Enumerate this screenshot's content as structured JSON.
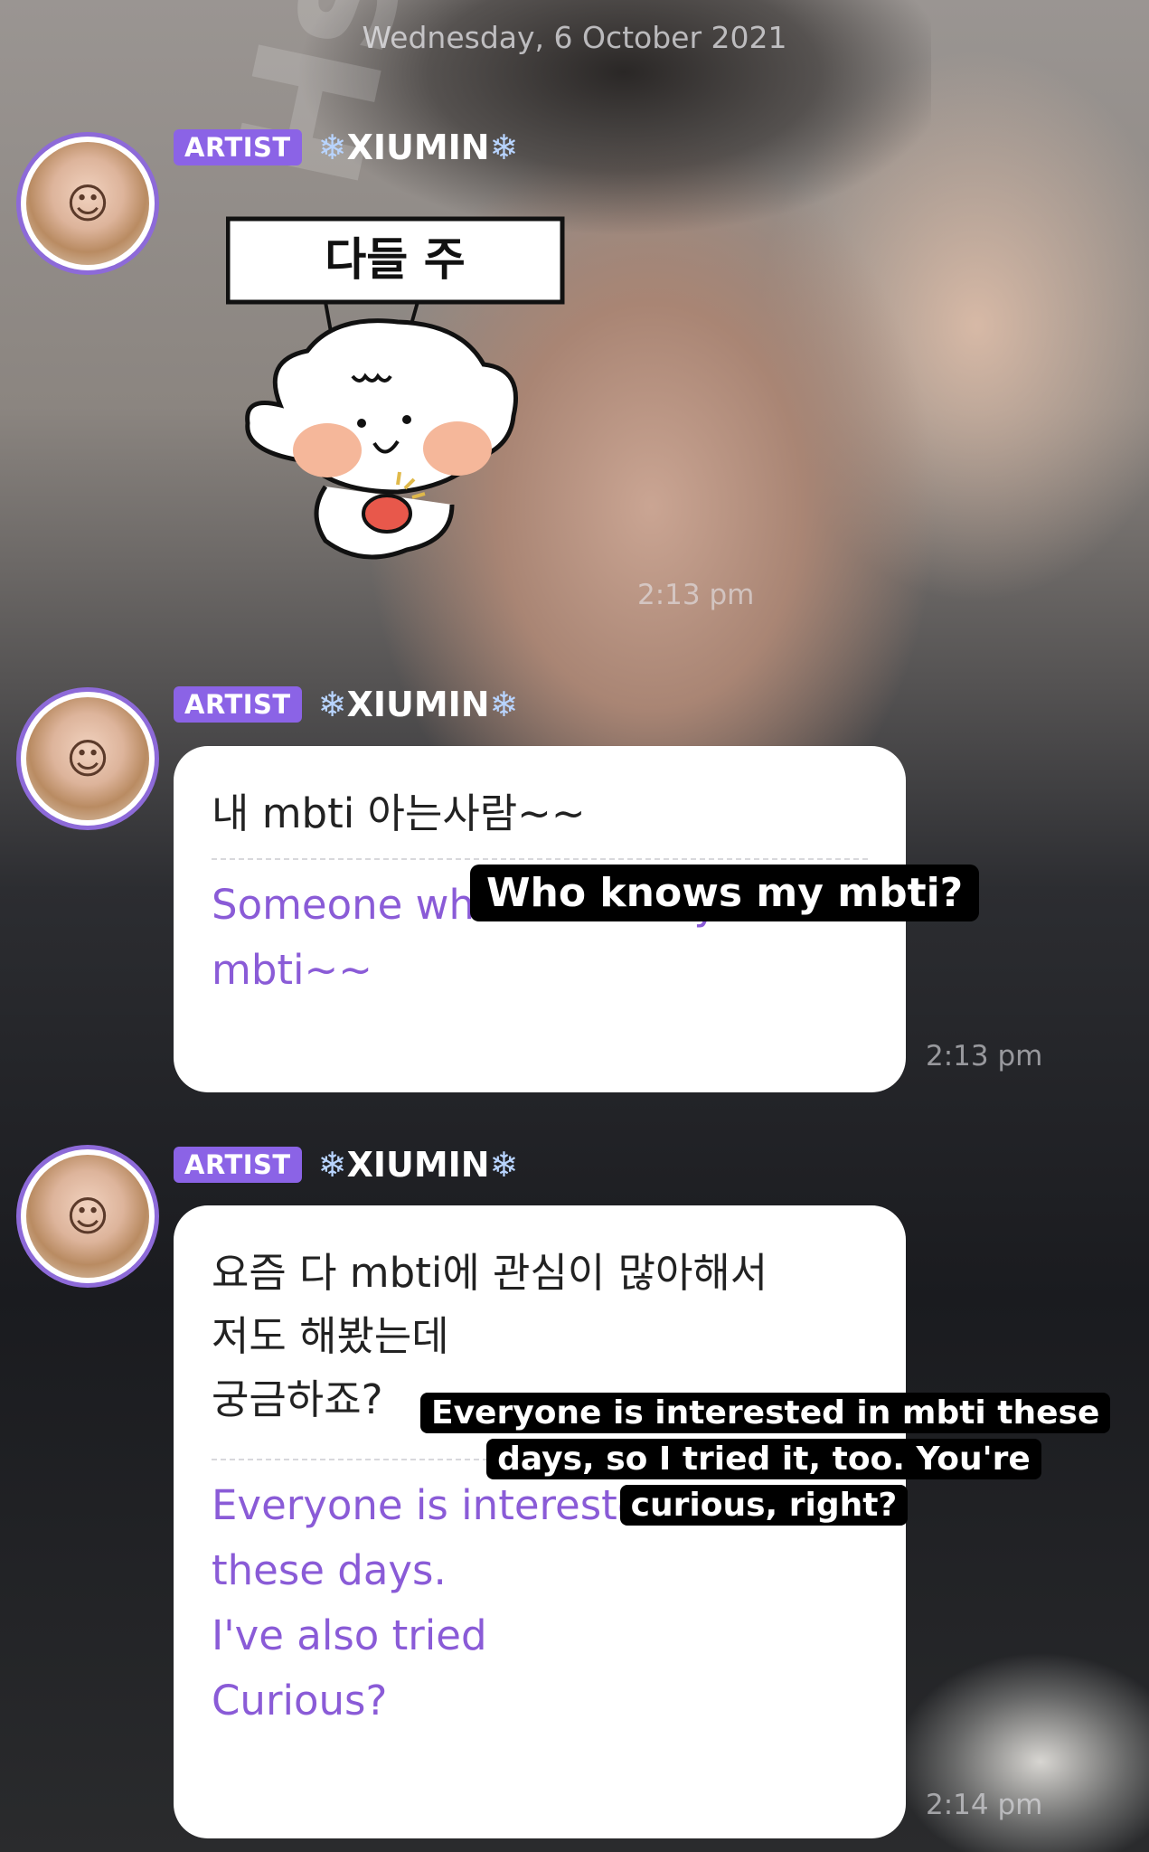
{
  "date_header": "Wednesday, 6 October 2021",
  "sender": {
    "badge": "ARTIST",
    "name": "XIUMIN",
    "name_decoration": "❄",
    "avatar_icon": "profile-photo"
  },
  "sticker": {
    "sign_text": "다들 주",
    "icon": "baby-character-sticker"
  },
  "messages": [
    {
      "type": "sticker",
      "time": "2:13 pm"
    },
    {
      "type": "text",
      "korean": "내 mbti 아는사람~~",
      "translation": "Someone who knows my\nmbti~~",
      "time": "2:13 pm"
    },
    {
      "type": "text",
      "korean": "요즘 다 mbti에 관심이 많아해서\n 저도 해봤는데\n궁금하죠?",
      "translation": "Everyone is interested in mbti\nthese days.\n I've also tried\nCurious?",
      "time": "2:14 pm"
    }
  ],
  "captions": [
    "Who knows my mbti?",
    "Everyone is interested in mbti these days, so I tried it, too. You're curious, right?"
  ],
  "watermark": "HsuHsuHsu",
  "colors": {
    "badge": "#8b63e6",
    "translation_text": "#8a5bd7",
    "avatar_ring": "#8d6ad8",
    "bubble": "#ffffff"
  }
}
